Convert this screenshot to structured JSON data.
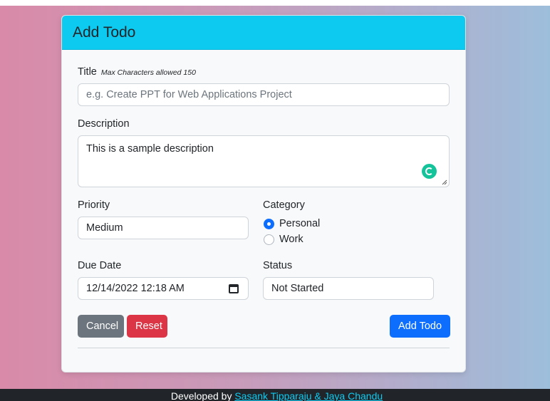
{
  "form": {
    "title": "Add Todo",
    "title_label": "Title",
    "title_hint": "Max Characters allowed 150",
    "title_placeholder": "e.g. Create PPT for Web Applications Project",
    "title_value": "",
    "description_label": "Description",
    "description_value": "This is a sample description",
    "priority_label": "Priority",
    "priority_value": "Medium",
    "category_label": "Category",
    "category_options": [
      {
        "label": "Personal",
        "checked": true
      },
      {
        "label": "Work",
        "checked": false
      }
    ],
    "due_date_label": "Due Date",
    "due_date_value": "12/14/2022 12:18 AM",
    "status_label": "Status",
    "status_value": "Not Started",
    "cancel_label": "Cancel",
    "reset_label": "Reset",
    "submit_label": "Add Todo"
  },
  "footer": {
    "prefix": "Developed by ",
    "authors": "Sasank Tipparaju & Jaya Chandu"
  },
  "colors": {
    "header": "#0dcaf0",
    "primary": "#0d6efd",
    "danger": "#dc3545",
    "secondary": "#6c757d",
    "grammarly": "#15c39a",
    "footer_bg": "#212529",
    "footer_link": "#0dcaf0"
  },
  "icons": [
    "grammarly-icon",
    "calendar-icon",
    "resize-grip-icon"
  ]
}
